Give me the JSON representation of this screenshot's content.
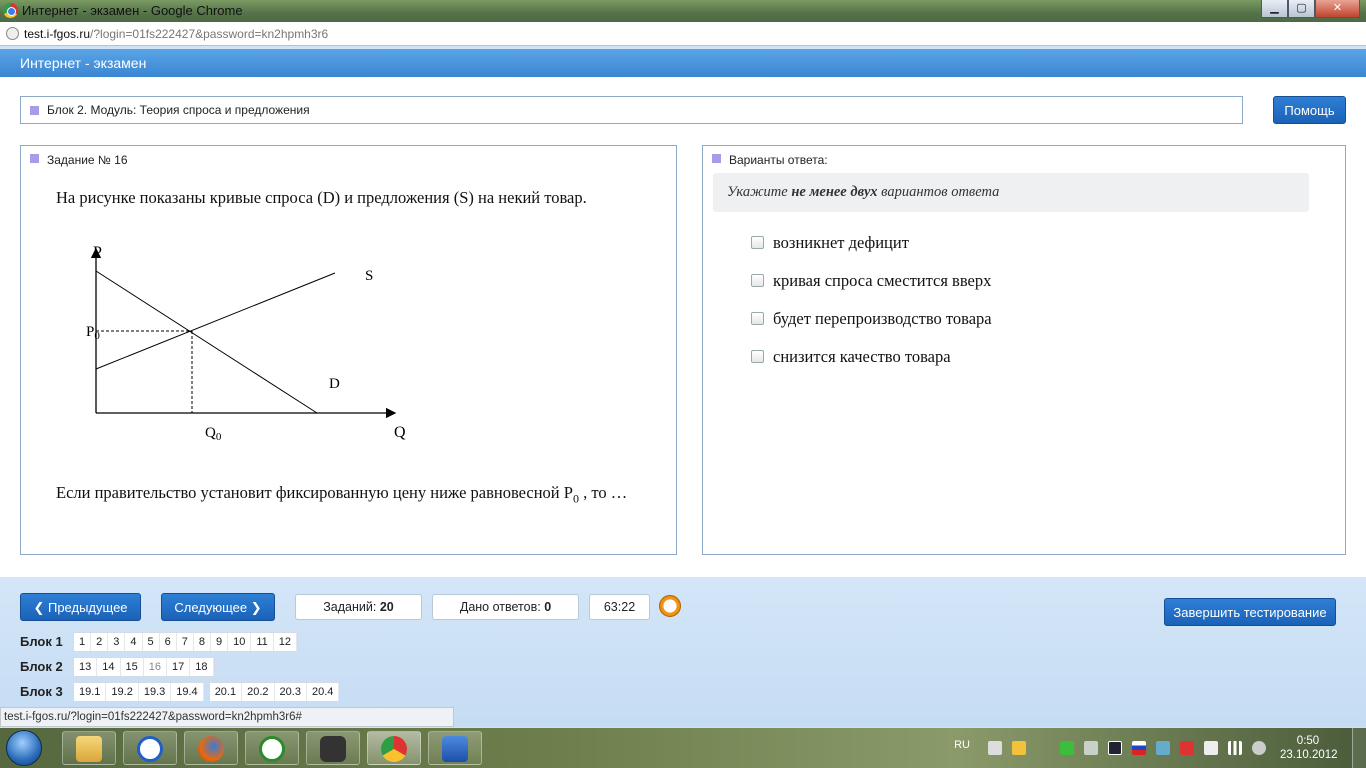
{
  "window": {
    "title": "Интернет - экзамен - Google Chrome",
    "controls": {
      "minimize": "▁",
      "maximize": "▢",
      "close": "✕"
    }
  },
  "address": {
    "host": "test.i-fgos.ru",
    "path": "/?login=01fs222427&password=kn2hpmh3r6"
  },
  "app": {
    "header": "Интернет - экзамен"
  },
  "block": {
    "title": "Блок 2. Модуль: Теория спроса и предложения"
  },
  "help_label": "Помощь",
  "question": {
    "heading": "Задание № 16",
    "text_before": "На рисунке показаны кривые спроса (D) и предложения (S) на некий товар.",
    "text_after_main": "Если правительство установит фиксированную цену ниже равновесной P",
    "text_after_sub": "0",
    "text_after_tail": " , то …",
    "graph": {
      "p_axis": "P",
      "q_axis": "Q",
      "p0": "P",
      "p0_sub": "0",
      "q0": "Q",
      "q0_sub": "0",
      "supply": "S",
      "demand": "D"
    }
  },
  "answers": {
    "heading": "Варианты ответа:",
    "hint_pre": "Укажите ",
    "hint_bold": "не менее двух",
    "hint_post": " вариантов ответа",
    "options": [
      {
        "label": "возникнет дефицит",
        "checked": false
      },
      {
        "label": "кривая спроса сместится вверх",
        "checked": false
      },
      {
        "label": "будет перепроизводство товара",
        "checked": false
      },
      {
        "label": "снизится качество товара",
        "checked": false
      }
    ]
  },
  "nav": {
    "prev": "Предыдущее",
    "next": "Следующее",
    "tasks_label": "Заданий:",
    "tasks_count": "20",
    "answered_label": "Дано ответов:",
    "answered_count": "0",
    "timer": "63:22",
    "finish": "Завершить тестирование",
    "prev_icon": "chevron-left-icon",
    "next_icon": "chevron-right-icon",
    "timer_icon": "alarm-clock-icon"
  },
  "blocks": [
    {
      "label": "Блок 1",
      "groups": [
        [
          "1",
          "2",
          "3",
          "4",
          "5",
          "6",
          "7",
          "8",
          "9",
          "10",
          "11",
          "12"
        ]
      ]
    },
    {
      "label": "Блок 2",
      "groups": [
        [
          "13",
          "14",
          "15",
          "16",
          "17",
          "18"
        ]
      ]
    },
    {
      "label": "Блок 3",
      "groups": [
        [
          "19.1",
          "19.2",
          "19.3",
          "19.4"
        ],
        [
          "20.1",
          "20.2",
          "20.3",
          "20.4"
        ]
      ]
    }
  ],
  "current_task": "16",
  "statusbar": "test.i-fgos.ru/?login=01fs222427&password=kn2hpmh3r6#",
  "taskbar": {
    "lang": "RU",
    "time": "0:50",
    "date": "23.10.2012"
  }
}
